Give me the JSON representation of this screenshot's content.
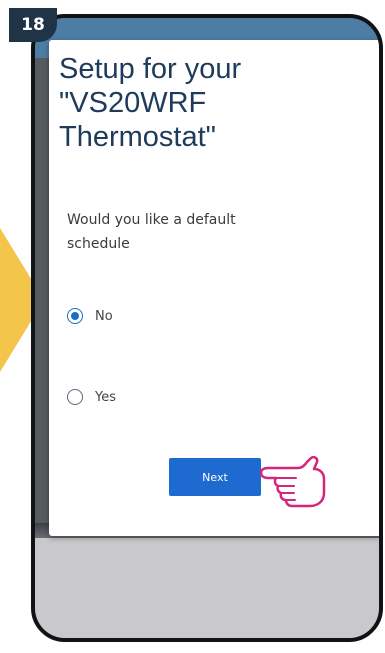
{
  "step": {
    "number": "18"
  },
  "dialog": {
    "title_line1": "Setup for your",
    "title_line2": "\"VS20WRF",
    "title_line3": "Thermostat\"",
    "question": "Would you like a default schedule",
    "options": [
      {
        "label": "No",
        "selected": true
      },
      {
        "label": "Yes",
        "selected": false
      }
    ],
    "next_label": "Next"
  },
  "colors": {
    "accent": "#1d6bd0",
    "title": "#1e3b5a",
    "arrow": "#f3c54a",
    "badge": "#1f3446",
    "hand": "#d6257a"
  },
  "icons": {
    "pointer": "pointing-hand-icon"
  }
}
